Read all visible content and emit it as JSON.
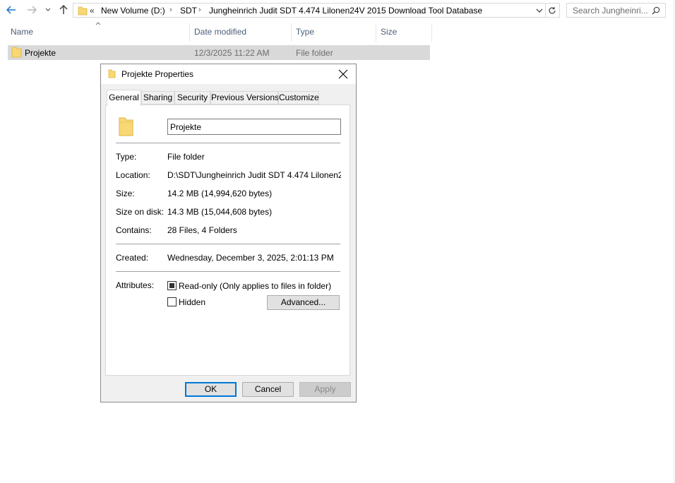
{
  "nav": {
    "back_icon": "arrow-left-icon",
    "forward_icon": "arrow-right-icon",
    "recent_icon": "chevron-down-icon",
    "up_icon": "arrow-up-icon",
    "overflow": "«",
    "breadcrumb": [
      "New Volume (D:)",
      "SDT",
      "Jungheinrich Judit SDT 4.474 Lilonen24V 2015 Download Tool Database"
    ],
    "search_placeholder": "Search Jungheinri..."
  },
  "columns": {
    "name": "Name",
    "date_modified": "Date modified",
    "type": "Type",
    "size": "Size"
  },
  "files": [
    {
      "name": "Projekte",
      "date_modified": "12/3/2025 11:22 AM",
      "type": "File folder",
      "size": ""
    }
  ],
  "dialog": {
    "title": "Projekte Properties",
    "tabs": [
      "General",
      "Sharing",
      "Security",
      "Previous Versions",
      "Customize"
    ],
    "active_tab": "General",
    "name_value": "Projekte",
    "fields": {
      "type_label": "Type:",
      "type_value": "File folder",
      "location_label": "Location:",
      "location_value": "D:\\SDT\\Jungheinrich Judit SDT 4.474 Lilonen24V 2",
      "size_label": "Size:",
      "size_value": "14.2 MB (14,994,620 bytes)",
      "size_on_disk_label": "Size on disk:",
      "size_on_disk_value": "14.3 MB (15,044,608 bytes)",
      "contains_label": "Contains:",
      "contains_value": "28 Files, 4 Folders",
      "created_label": "Created:",
      "created_value": "Wednesday, December 3, 2025, 2:01:13 PM",
      "attributes_label": "Attributes:",
      "readonly_label": "Read-only (Only applies to files in folder)",
      "readonly_state": "indeterminate",
      "hidden_label": "Hidden",
      "hidden_state": "unchecked"
    },
    "buttons": {
      "advanced": "Advanced...",
      "ok": "OK",
      "cancel": "Cancel",
      "apply": "Apply"
    }
  },
  "colors": {
    "accent": "#0078d7",
    "folder": "#f8d775",
    "header_text": "#4c607a",
    "selection": "#d9d9d9"
  }
}
